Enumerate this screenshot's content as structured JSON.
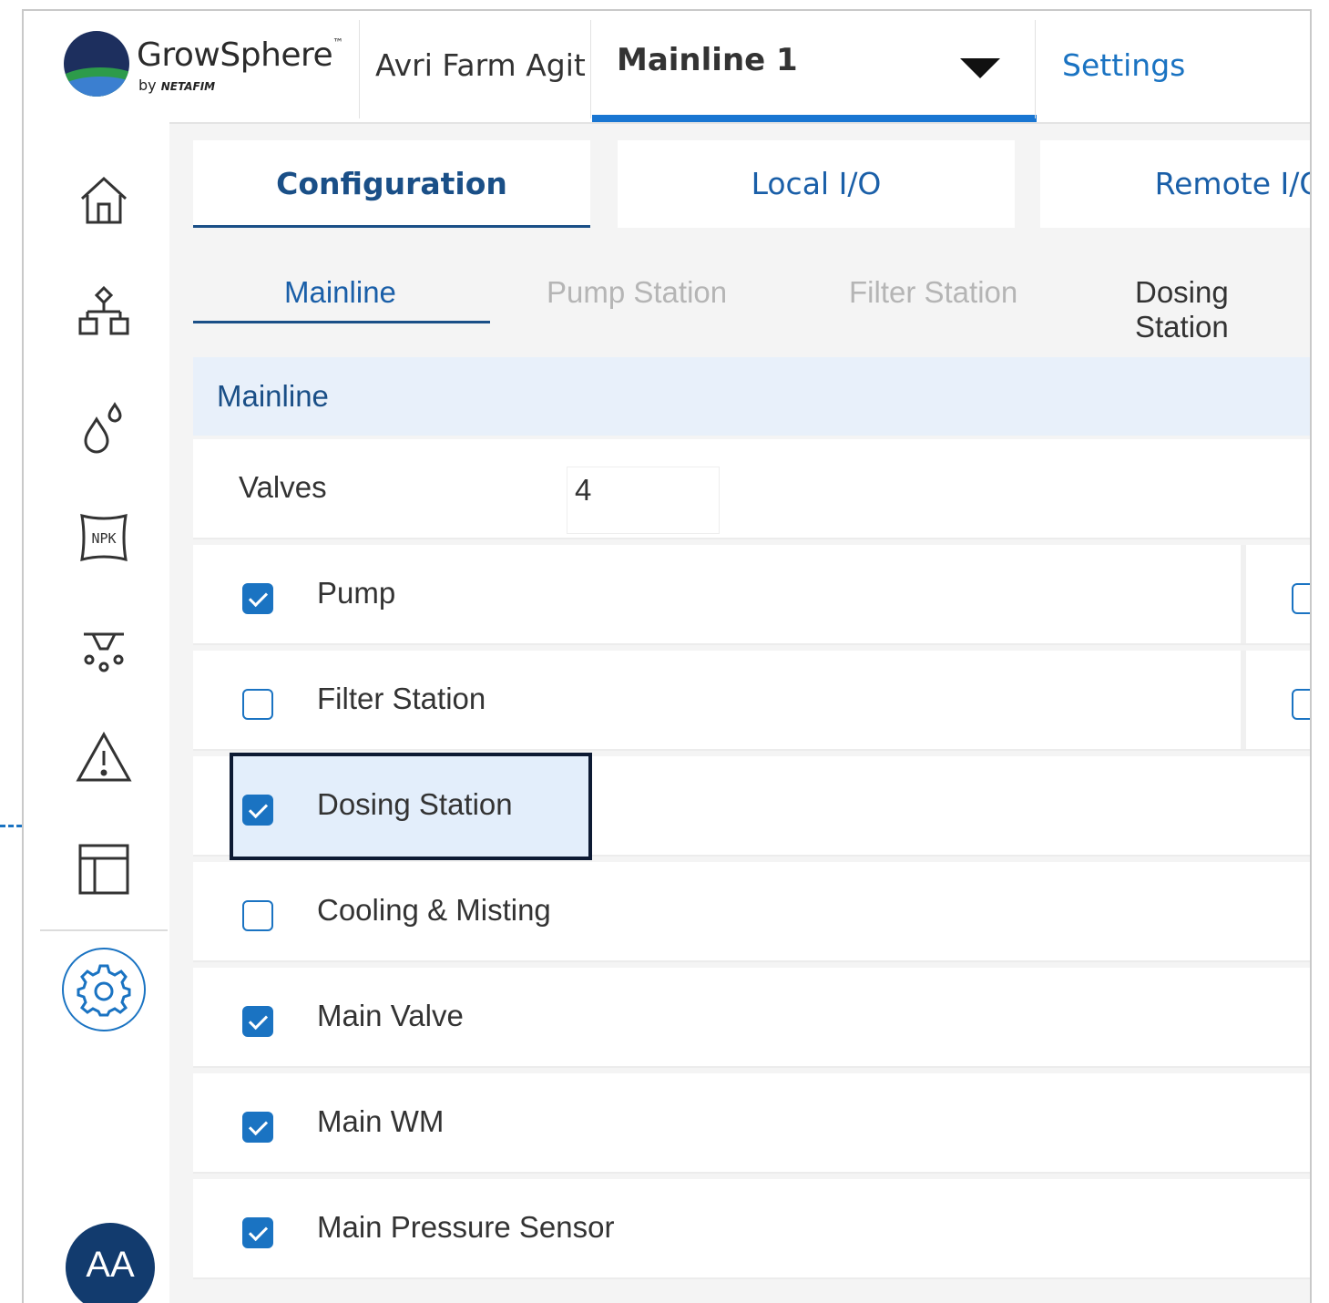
{
  "header": {
    "brand_name": "GrowSphere",
    "brand_tm": "™",
    "brand_by": "by",
    "brand_company": "NETAFIM",
    "farm_name": "Avri Farm Agit",
    "mainline_selected": "Mainline 1",
    "settings_label": "Settings"
  },
  "tabs": [
    {
      "label": "Configuration",
      "active": true
    },
    {
      "label": "Local I/O",
      "active": false
    },
    {
      "label": "Remote I/O",
      "active": false
    }
  ],
  "subtabs": [
    {
      "label": "Mainline",
      "active": true
    },
    {
      "label": "Pump Station",
      "active": false
    },
    {
      "label": "Filter Station",
      "active": false
    },
    {
      "label": "Dosing Station",
      "active": false
    }
  ],
  "section": {
    "title": "Mainline"
  },
  "valves": {
    "label": "Valves",
    "value": "4"
  },
  "options": [
    {
      "label": "Pump",
      "checked": true
    },
    {
      "label": "Filter Station",
      "checked": false
    },
    {
      "label": "Dosing Station",
      "checked": true,
      "highlighted": true
    },
    {
      "label": "Cooling & Misting",
      "checked": false
    },
    {
      "label": "Main Valve",
      "checked": true
    },
    {
      "label": "Main WM",
      "checked": true
    },
    {
      "label": "Main Pressure Sensor",
      "checked": true
    }
  ],
  "user": {
    "initials": "AA"
  },
  "colors": {
    "accent": "#1a73c2",
    "nav_dark": "#1a4f87",
    "avatar": "#123b6e"
  },
  "sidebar_icons": [
    "home-icon",
    "hierarchy-icon",
    "water-drops-icon",
    "npk-fertilizer-icon",
    "sprinkler-icon",
    "warning-icon",
    "layout-table-icon",
    "gear-icon"
  ]
}
